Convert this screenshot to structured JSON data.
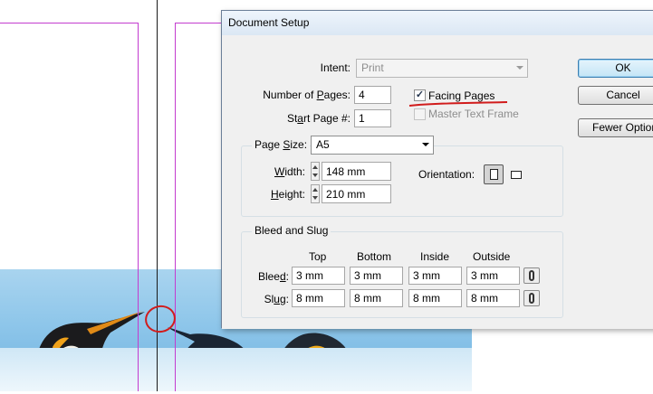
{
  "dialog": {
    "title": "Document Setup",
    "intent_label": "Intent:",
    "intent_value": "Print",
    "num_pages_label": "Number of Pages:",
    "num_pages_value": "4",
    "start_page_label": "Start Page #:",
    "start_page_value": "1",
    "facing_pages_label": "Facing Pages",
    "facing_pages_checked": true,
    "master_text_frame_label": "Master Text Frame",
    "master_text_frame_checked": false,
    "page_size_label": "Page Size:",
    "page_size_value": "A5",
    "width_label": "Width:",
    "width_value": "148 mm",
    "height_label": "Height:",
    "height_value": "210 mm",
    "orientation_label": "Orientation:",
    "orientation_selected": "portrait",
    "bleed_slug_title": "Bleed and Slug",
    "columns": [
      "Top",
      "Bottom",
      "Inside",
      "Outside"
    ],
    "bleed_label": "Bleed:",
    "bleed_values": [
      "3 mm",
      "3 mm",
      "3 mm",
      "3 mm"
    ],
    "slug_label": "Slug:",
    "slug_values": [
      "8 mm",
      "8 mm",
      "8 mm",
      "8 mm"
    ],
    "ok_button": "OK",
    "cancel_button": "Cancel",
    "fewer_options_button": "Fewer Options"
  },
  "colors": {
    "margin_guide": "#c33ccf",
    "annotation_red": "#d11c1c"
  },
  "icons": {
    "portrait": "portrait-orientation-icon",
    "landscape": "landscape-orientation-icon",
    "link": "chain-link-icon"
  }
}
